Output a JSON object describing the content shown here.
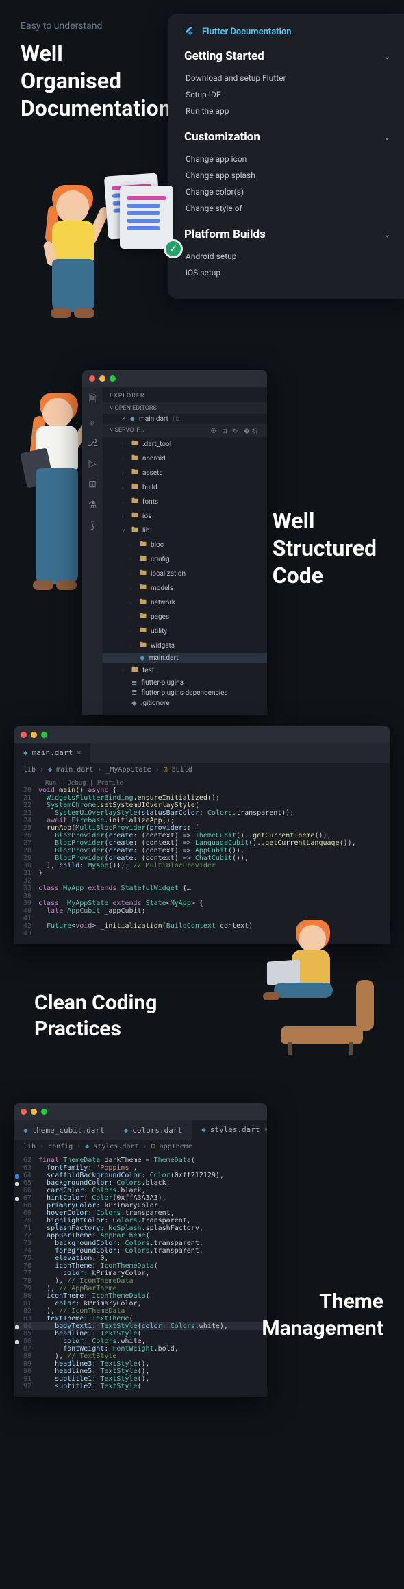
{
  "section1": {
    "eyebrow": "Easy to understand",
    "title_l1": "Well",
    "title_l2": "Organised",
    "title_l3": "Documentation",
    "card": {
      "brand": "Flutter Documentation",
      "groups": [
        {
          "title": "Getting Started",
          "items": [
            "Download and setup Flutter",
            "Setup IDE",
            "Run the app"
          ]
        },
        {
          "title": "Customization",
          "items": [
            "Change app icon",
            "Change app splash",
            "Change color(s)",
            "Change style of"
          ]
        },
        {
          "title": "Platform Builds",
          "items": [
            "Android setup",
            "iOS setup"
          ]
        }
      ]
    }
  },
  "section2": {
    "title_l1": "Well",
    "title_l2": "Structured",
    "title_l3": "Code",
    "explorer_label": "EXPLORER",
    "open_editors": "OPEN EDITORS",
    "open_file": "main.dart",
    "open_file_path": "lib",
    "project": "SERVO_P...",
    "tree": [
      {
        "d": 1,
        "t": ".dart_tool",
        "folder": true,
        "open": false
      },
      {
        "d": 1,
        "t": "android",
        "folder": true,
        "open": false
      },
      {
        "d": 1,
        "t": "assets",
        "folder": true,
        "open": false
      },
      {
        "d": 1,
        "t": "build",
        "folder": true,
        "open": false
      },
      {
        "d": 1,
        "t": "fonts",
        "folder": true,
        "open": false
      },
      {
        "d": 1,
        "t": "ios",
        "folder": true,
        "open": false
      },
      {
        "d": 1,
        "t": "lib",
        "folder": true,
        "open": true
      },
      {
        "d": 2,
        "t": "bloc",
        "folder": true,
        "open": false
      },
      {
        "d": 2,
        "t": "config",
        "folder": true,
        "open": false
      },
      {
        "d": 2,
        "t": "localization",
        "folder": true,
        "open": false
      },
      {
        "d": 2,
        "t": "models",
        "folder": true,
        "open": false
      },
      {
        "d": 2,
        "t": "network",
        "folder": true,
        "open": false
      },
      {
        "d": 2,
        "t": "pages",
        "folder": true,
        "open": false
      },
      {
        "d": 2,
        "t": "utility",
        "folder": true,
        "open": false
      },
      {
        "d": 2,
        "t": "widgets",
        "folder": true,
        "open": false
      },
      {
        "d": 2,
        "t": "main.dart",
        "folder": false
      },
      {
        "d": 1,
        "t": "test",
        "folder": true,
        "open": false
      },
      {
        "d": 1,
        "t": "flutter-plugins",
        "folder": false,
        "icon": "≣"
      },
      {
        "d": 1,
        "t": "flutter-plugins-dependencies",
        "folder": false,
        "icon": "≣"
      },
      {
        "d": 1,
        "t": ".gitignore",
        "folder": false,
        "icon": "◆"
      }
    ]
  },
  "section3": {
    "title_l1": "Clean Coding",
    "title_l2": "Practices",
    "tab": "main.dart",
    "crumbs": [
      "lib",
      "main.dart",
      "_MyAppState",
      "build"
    ],
    "run_hint": "Run | Debug | Profile",
    "code": [
      {
        "n": 20,
        "h": "<span class='kw'>void</span> <span class='fn'>main</span>() <span class='kw'>async</span> {"
      },
      {
        "n": 21,
        "h": "  <span class='cls'>WidgetsFlutterBinding</span>.<span class='fn'>ensureInitialized</span>();"
      },
      {
        "n": 22,
        "h": "  <span class='cls'>SystemChrome</span>.<span class='fn'>setSystemUIOverlayStyle</span>("
      },
      {
        "n": 23,
        "h": "    <span class='cls'>SystemUiOverlayStyle</span>(<span class='pr'>statusBarColor</span>: <span class='cls'>Colors</span>.transparent));"
      },
      {
        "n": 24,
        "h": "  <span class='kw'>await</span> <span class='cls'>Firebase</span>.<span class='fn'>initializeApp</span>();"
      },
      {
        "n": 25,
        "h": "  <span class='fn'>runApp</span>(<span class='cls'>MultiBlocProvider</span>(<span class='pr'>providers</span>: ["
      },
      {
        "n": 26,
        "h": "    <span class='cls'>BlocProvider</span>(<span class='pr'>create</span>: (context) =&gt; <span class='cls'>ThemeCubit</span>()..<span class='fn'>getCurrentTheme</span>()),"
      },
      {
        "n": 27,
        "h": "    <span class='cls'>BlocProvider</span>(<span class='pr'>create</span>: (context) =&gt; <span class='cls'>LanguageCubit</span>()..<span class='fn'>getCurrentLanguage</span>()),"
      },
      {
        "n": 28,
        "h": "    <span class='cls'>BlocProvider</span>(<span class='pr'>create</span>: (context) =&gt; <span class='cls'>AppCubit</span>()),"
      },
      {
        "n": 29,
        "h": "    <span class='cls'>BlocProvider</span>(<span class='pr'>create</span>: (context) =&gt; <span class='cls'>ChatCubit</span>()),"
      },
      {
        "n": 30,
        "h": "  ], <span class='pr'>child</span>: <span class='cls'>MyApp</span>())); <span class='cm'>// MultiBlocProvider</span>"
      },
      {
        "n": 31,
        "h": "}"
      },
      {
        "n": 32,
        "h": ""
      },
      {
        "n": 33,
        "h": "<span class='kw'>class</span> <span class='cls'>MyApp</span> <span class='kw'>extends</span> <span class='cls'>StatefulWidget</span> {<span class='op'>…</span>"
      },
      {
        "n": 38,
        "h": ""
      },
      {
        "n": 39,
        "h": "<span class='kw'>class</span> <span class='cls'>_MyAppState</span> <span class='kw'>extends</span> <span class='cls'>State</span>&lt;<span class='cls'>MyApp</span>&gt; {"
      },
      {
        "n": 40,
        "h": "  <span class='kw'>late</span> <span class='cls'>AppCubit</span> _appCubit;"
      },
      {
        "n": 41,
        "h": ""
      },
      {
        "n": 42,
        "h": "  <span class='cls'>Future</span>&lt;<span class='kw'>void</span>&gt; <span class='fn'>_initialization</span>(<span class='cls'>BuildContext</span> context)"
      },
      {
        "n": 43,
        "h": ""
      }
    ]
  },
  "section4": {
    "title_l1": "Theme",
    "title_l2": "Management",
    "tabs": [
      "theme_cubit.dart",
      "colors.dart",
      "styles.dart"
    ],
    "active_tab": 2,
    "crumbs": [
      "lib",
      "config",
      "styles.dart",
      "appTheme"
    ],
    "code": [
      {
        "n": 62,
        "h": "<span class='kw'>final</span> <span class='cls'>ThemeData</span> darkTheme = <span class='cls'>ThemeData</span>("
      },
      {
        "n": 63,
        "h": "  <span class='pr'>fontFamily</span>: <span class='str'>'Poppins'</span>,"
      },
      {
        "n": 64,
        "h": "  <span class='pr'>scaffoldBackgroundColor</span>: <span class='cls'>Color</span>(0xff212129),",
        "dot": "b"
      },
      {
        "n": 65,
        "h": "  <span class='pr'>backgroundColor</span>: <span class='cls'>Colors</span>.black,",
        "dot": "w"
      },
      {
        "n": 66,
        "h": "  <span class='pr'>cardColor</span>: <span class='cls'>Colors</span>.black,"
      },
      {
        "n": 67,
        "h": "  <span class='pr'>hintColor</span>: <span class='cls'>Color</span>(0xffA3A3A3),",
        "dot": "w"
      },
      {
        "n": 68,
        "h": "  <span class='pr'>primaryColor</span>: kPrimaryColor,"
      },
      {
        "n": 69,
        "h": "  <span class='pr'>hoverColor</span>: <span class='cls'>Colors</span>.transparent,"
      },
      {
        "n": 70,
        "h": "  <span class='pr'>highlightColor</span>: <span class='cls'>Colors</span>.transparent,"
      },
      {
        "n": 71,
        "h": "  <span class='pr'>splashFactory</span>: <span class='cls'>NoSplash</span>.splashFactory,"
      },
      {
        "n": 72,
        "h": "  <span class='pr'>appBarTheme</span>: <span class='cls'>AppBarTheme</span>("
      },
      {
        "n": 73,
        "h": "    <span class='pr'>backgroundColor</span>: <span class='cls'>Colors</span>.transparent,"
      },
      {
        "n": 74,
        "h": "    <span class='pr'>foregroundColor</span>: <span class='cls'>Colors</span>.transparent,"
      },
      {
        "n": 75,
        "h": "    <span class='pr'>elevation</span>: 0,"
      },
      {
        "n": 76,
        "h": "    <span class='pr'>iconTheme</span>: <span class='cls'>IconThemeData</span>("
      },
      {
        "n": 77,
        "h": "      <span class='pr'>color</span>: kPrimaryColor,"
      },
      {
        "n": 78,
        "h": "    ), <span class='cm'>// IconThemeData</span>"
      },
      {
        "n": 79,
        "h": "  ), <span class='cm'>// AppBarTheme</span>"
      },
      {
        "n": 80,
        "h": "  <span class='pr'>iconTheme</span>: <span class='cls'>IconThemeData</span>("
      },
      {
        "n": 81,
        "h": "    <span class='pr'>color</span>: kPrimaryColor,"
      },
      {
        "n": 82,
        "h": "  ), <span class='cm'>// IconThemeData</span>"
      },
      {
        "n": 83,
        "h": "  <span class='pr'>textTheme</span>: <span class='cls'>TextTheme</span>("
      },
      {
        "n": 84,
        "h": "    <span class='pr'>bodyText1</span>: <span class='cls'>TextStyle</span>(<span class='pr'>color</span>: <span class='cls'>Colors</span>.white),",
        "dot": "w",
        "sel": true
      },
      {
        "n": 85,
        "h": "    <span class='pr'>headline1</span>: <span class='cls'>TextStyle</span>("
      },
      {
        "n": 86,
        "h": "      <span class='pr'>color</span>: <span class='cls'>Colors</span>.white,",
        "dot": "w"
      },
      {
        "n": 87,
        "h": "      <span class='pr'>fontWeight</span>: <span class='cls'>FontWeight</span>.bold,"
      },
      {
        "n": 88,
        "h": "    ), <span class='cm'>// TextStyle</span>"
      },
      {
        "n": 89,
        "h": "    <span class='pr'>headline3</span>: <span class='cls'>TextStyle</span>(),"
      },
      {
        "n": 90,
        "h": "    <span class='pr'>headline5</span>: <span class='cls'>TextStyle</span>(),"
      },
      {
        "n": 91,
        "h": "    <span class='pr'>subtitle1</span>: <span class='cls'>TextStyle</span>(),"
      },
      {
        "n": 92,
        "h": "    <span class='pr'>subtitle2</span>: <span class='cls'>TextStyle</span>("
      }
    ]
  }
}
